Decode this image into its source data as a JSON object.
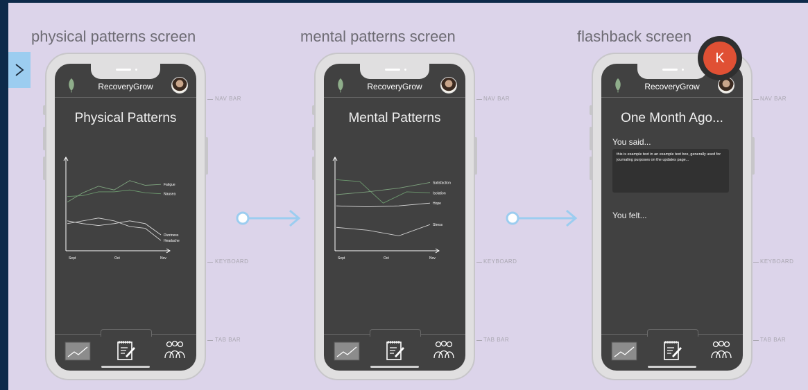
{
  "frames": [
    {
      "label": "physical patterns screen",
      "app_name": "RecoveryGrow",
      "screen_title": "Physical Patterns",
      "chart_data": {
        "type": "line",
        "categories": [
          "Sept",
          "Oct",
          "Nov"
        ],
        "series": [
          {
            "name": "Fatigue",
            "values": [
              5.2,
              6.2,
              6.9,
              6.5,
              7.5,
              7.0,
              7.1
            ]
          },
          {
            "name": "Nausea",
            "values": [
              5.8,
              5.9,
              6.3,
              6.3,
              6.5,
              6.2,
              6.1
            ]
          },
          {
            "name": "Dizziness",
            "values": [
              3.2,
              2.9,
              2.7,
              2.9,
              3.2,
              2.9,
              1.7
            ]
          },
          {
            "name": "Headache",
            "values": [
              2.9,
              3.2,
              3.5,
              3.2,
              2.6,
              2.4,
              1.1
            ]
          }
        ],
        "xlabel": "",
        "ylabel": ""
      }
    },
    {
      "label": "mental patterns screen",
      "app_name": "RecoveryGrow",
      "screen_title": "Mental Patterns",
      "chart_data": {
        "type": "line",
        "categories": [
          "Sept",
          "Oct",
          "Nov"
        ],
        "series": [
          {
            "name": "Satisfaction",
            "values": [
              6.0,
              6.3,
              6.7,
              7.3
            ]
          },
          {
            "name": "Isolation",
            "values": [
              7.6,
              7.4,
              5.1,
              6.3,
              6.2
            ]
          },
          {
            "name": "Hope",
            "values": [
              4.8,
              4.7,
              4.8,
              5.1
            ]
          },
          {
            "name": "Stress",
            "values": [
              2.5,
              2.2,
              1.6,
              2.8
            ]
          }
        ],
        "xlabel": "",
        "ylabel": ""
      }
    },
    {
      "label": "flashback screen",
      "app_name": "RecoveryGrow",
      "screen_title": "One Month Ago...",
      "you_said_label": "You said...",
      "journal_text": "this is example text in an example text box, generally used for journaling purposes on the updates page...",
      "you_felt_label": "You felt..."
    }
  ],
  "side_labels": {
    "nav": "NAV BAR",
    "keyboard": "KEYBOARD",
    "tab": "TAB BAR"
  },
  "collaborator_initial": "K",
  "icons": {
    "leaf": "leaf-icon",
    "avatar": "avatar",
    "tabs": [
      "chart-icon",
      "journal-icon",
      "community-icon"
    ]
  },
  "colors": {
    "canvas": "#dcd4ea",
    "screen": "#414141",
    "accent_blue": "#9ccdf0",
    "leaf_green": "#8fae8b",
    "collaborator": "#e05034"
  }
}
